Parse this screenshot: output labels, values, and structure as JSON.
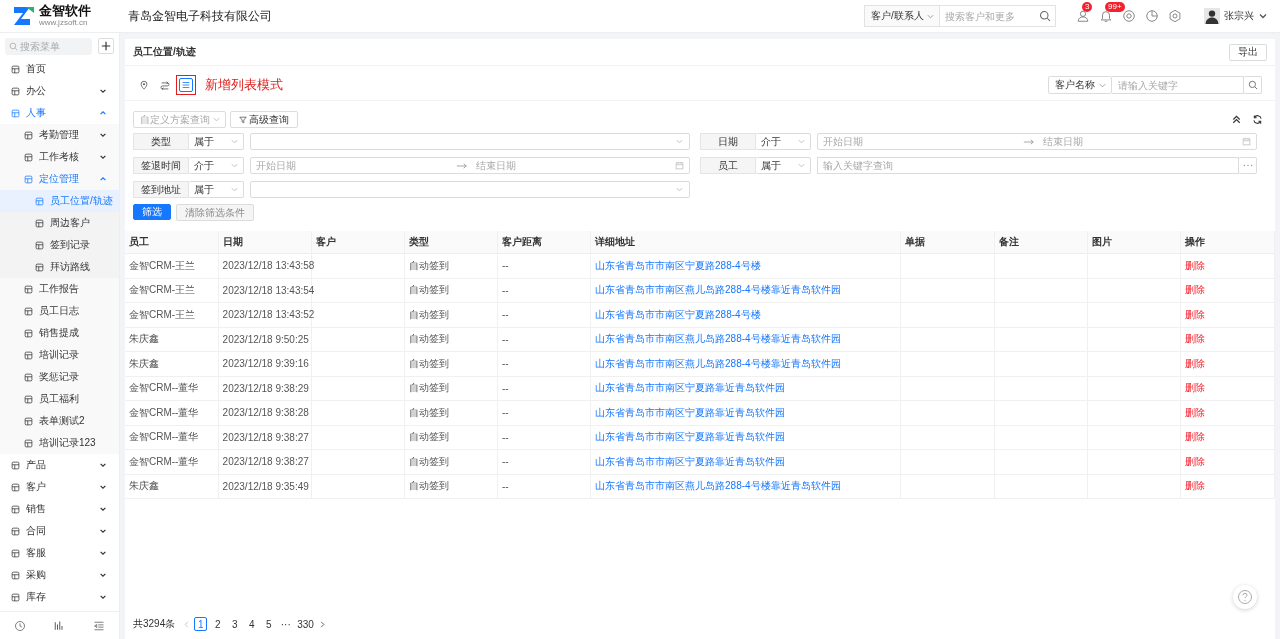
{
  "header": {
    "logo_text": "金智软件",
    "logo_url": "www.jzsoft.cn",
    "company": "青岛金智电子科技有限公司",
    "search_scope": "客户/联系人",
    "search_placeholder": "搜索客户和更多",
    "badges": [
      "3",
      "99+"
    ],
    "user_name": "张宗兴"
  },
  "sidebar": {
    "search_placeholder": "搜索菜单",
    "items": [
      {
        "label": "首页",
        "selected": false
      },
      {
        "label": "办公",
        "selected": false,
        "expanded": false
      },
      {
        "label": "人事",
        "selected": false,
        "expanded": true,
        "children": [
          {
            "label": "考勤管理",
            "selected": false,
            "expanded": false
          },
          {
            "label": "工作考核",
            "selected": false,
            "expanded": false
          },
          {
            "label": "定位管理",
            "selected": false,
            "expanded": true,
            "children": [
              {
                "label": "员工位置/轨迹",
                "selected": true
              },
              {
                "label": "周边客户",
                "selected": false
              },
              {
                "label": "签到记录",
                "selected": false
              },
              {
                "label": "拜访路线",
                "selected": false
              }
            ]
          },
          {
            "label": "工作报告",
            "selected": false
          },
          {
            "label": "员工日志",
            "selected": false
          },
          {
            "label": "销售提成",
            "selected": false
          },
          {
            "label": "培训记录",
            "selected": false
          },
          {
            "label": "奖惩记录",
            "selected": false
          },
          {
            "label": "员工福利",
            "selected": false
          },
          {
            "label": "表单测试2",
            "selected": false
          },
          {
            "label": "培训记录123",
            "selected": false
          }
        ]
      },
      {
        "label": "产品",
        "selected": false,
        "expanded": false
      },
      {
        "label": "客户",
        "selected": false,
        "expanded": false
      },
      {
        "label": "销售",
        "selected": false,
        "expanded": false
      },
      {
        "label": "合同",
        "selected": false,
        "expanded": false
      },
      {
        "label": "客服",
        "selected": false,
        "expanded": false
      },
      {
        "label": "采购",
        "selected": false,
        "expanded": false
      },
      {
        "label": "库存",
        "selected": false,
        "expanded": false
      }
    ]
  },
  "page": {
    "title": "员工位置/轨迹",
    "export_button": "导出",
    "view_modes": [
      {
        "kind": "map",
        "selected": false,
        "highlighted": false
      },
      {
        "kind": "route",
        "selected": false,
        "highlighted": false
      },
      {
        "kind": "list",
        "selected": true,
        "highlighted": true
      }
    ],
    "annotation": "新增列表模式",
    "quick_search": {
      "field": "客户名称",
      "placeholder": "请输入关键字"
    },
    "scheme_placeholder": "自定义方案查询",
    "advanced_button": "高级查询",
    "filters": [
      {
        "kind": "select",
        "label": "类型",
        "operator": "属于"
      },
      {
        "kind": "daterange",
        "label": "日期",
        "operator": "介于",
        "start_placeholder": "开始日期",
        "end_placeholder": "结束日期"
      },
      {
        "kind": "daterange",
        "label": "签退时间",
        "operator": "介于",
        "start_placeholder": "开始日期",
        "end_placeholder": "结束日期"
      },
      {
        "kind": "picker",
        "label": "员工",
        "operator": "属于",
        "placeholder": "输入关键字查询"
      },
      {
        "kind": "select",
        "label": "签到地址",
        "operator": "属于"
      }
    ],
    "filter_button": "筛选",
    "clear_button": {
      "label": "清除筛选条件",
      "disabled": true
    }
  },
  "table": {
    "columns": [
      "员工",
      "日期",
      "客户",
      "类型",
      "客户距离",
      "详细地址",
      "单据",
      "备注",
      "图片",
      "操作"
    ],
    "rows": [
      {
        "employee": "金智CRM-王兰",
        "date": "2023/12/18 13:43:58",
        "type": "自动签到",
        "distance": "--",
        "address": "山东省青岛市市南区宁夏路288-4号楼",
        "action": "删除"
      },
      {
        "employee": "金智CRM-王兰",
        "date": "2023/12/18 13:43:54",
        "type": "自动签到",
        "distance": "--",
        "address": "山东省青岛市市南区燕儿岛路288-4号楼靠近青岛软件园",
        "action": "删除"
      },
      {
        "employee": "金智CRM-王兰",
        "date": "2023/12/18 13:43:52",
        "type": "自动签到",
        "distance": "--",
        "address": "山东省青岛市市南区宁夏路288-4号楼",
        "action": "删除"
      },
      {
        "employee": "朱庆鑫",
        "date": "2023/12/18 9:50:25",
        "type": "自动签到",
        "distance": "--",
        "address": "山东省青岛市市南区燕儿岛路288-4号楼靠近青岛软件园",
        "action": "删除"
      },
      {
        "employee": "朱庆鑫",
        "date": "2023/12/18 9:39:16",
        "type": "自动签到",
        "distance": "--",
        "address": "山东省青岛市市南区燕儿岛路288-4号楼靠近青岛软件园",
        "action": "删除"
      },
      {
        "employee": "金智CRM--董华",
        "date": "2023/12/18 9:38:29",
        "type": "自动签到",
        "distance": "--",
        "address": "山东省青岛市市南区宁夏路靠近青岛软件园",
        "action": "删除"
      },
      {
        "employee": "金智CRM--董华",
        "date": "2023/12/18 9:38:28",
        "type": "自动签到",
        "distance": "--",
        "address": "山东省青岛市市南区宁夏路靠近青岛软件园",
        "action": "删除"
      },
      {
        "employee": "金智CRM--董华",
        "date": "2023/12/18 9:38:27",
        "type": "自动签到",
        "distance": "--",
        "address": "山东省青岛市市南区宁夏路靠近青岛软件园",
        "action": "删除"
      },
      {
        "employee": "金智CRM--董华",
        "date": "2023/12/18 9:38:27",
        "type": "自动签到",
        "distance": "--",
        "address": "山东省青岛市市南区宁夏路靠近青岛软件园",
        "action": "删除"
      },
      {
        "employee": "朱庆鑫",
        "date": "2023/12/18 9:35:49",
        "type": "自动签到",
        "distance": "--",
        "address": "山东省青岛市市南区燕儿岛路288-4号楼靠近青岛软件园",
        "action": "删除"
      }
    ]
  },
  "pagination": {
    "total": "共3294条",
    "pages": [
      {
        "label": "1",
        "selected": true
      },
      {
        "label": "2",
        "selected": false
      },
      {
        "label": "3",
        "selected": false
      },
      {
        "label": "4",
        "selected": false
      },
      {
        "label": "5",
        "selected": false
      },
      {
        "label": "···",
        "selected": false
      },
      {
        "label": "330",
        "selected": false
      }
    ]
  }
}
